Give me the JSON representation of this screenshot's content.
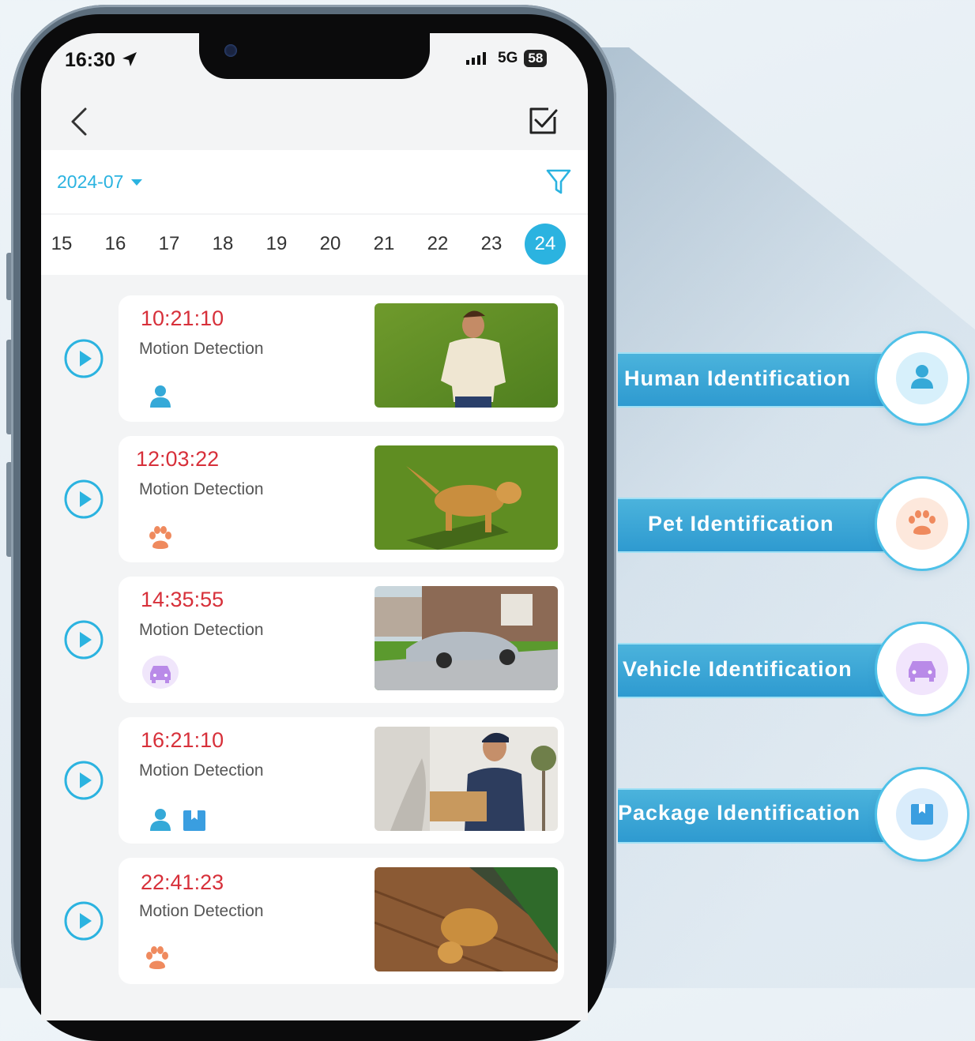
{
  "status_bar": {
    "time": "16:30",
    "network": "5G",
    "battery": "58"
  },
  "header": {
    "month": "2024-07"
  },
  "days": [
    {
      "label": "15",
      "active": false
    },
    {
      "label": "16",
      "active": false
    },
    {
      "label": "17",
      "active": false
    },
    {
      "label": "18",
      "active": false
    },
    {
      "label": "19",
      "active": false
    },
    {
      "label": "20",
      "active": false
    },
    {
      "label": "21",
      "active": false
    },
    {
      "label": "22",
      "active": false
    },
    {
      "label": "23",
      "active": false
    },
    {
      "label": "24",
      "active": true
    }
  ],
  "events": [
    {
      "time": "10:21:10",
      "label": "Motion Detection",
      "tags": [
        "person-icon"
      ]
    },
    {
      "time": "12:03:22",
      "label": "Motion Detection",
      "tags": [
        "paw-icon"
      ]
    },
    {
      "time": "14:35:55",
      "label": "Motion Detection",
      "tags": [
        "car-icon"
      ]
    },
    {
      "time": "16:21:10",
      "label": "Motion Detection",
      "tags": [
        "person-icon",
        "package-icon"
      ]
    },
    {
      "time": "22:41:23",
      "label": "Motion Detection",
      "tags": [
        "paw-icon"
      ]
    }
  ],
  "callouts": [
    {
      "label": "Human Identification",
      "icon": "person-icon",
      "color": "#35a9d8"
    },
    {
      "label": "Pet Identification",
      "icon": "paw-icon",
      "color": "#ef8a5e"
    },
    {
      "label": "Vehicle Identification",
      "icon": "car-icon",
      "color": "#b98ae8"
    },
    {
      "label": "Package Identification",
      "icon": "package-icon",
      "color": "#3a9ee0"
    }
  ],
  "colors": {
    "accent": "#2bb3e0",
    "time_red": "#d7303a"
  }
}
